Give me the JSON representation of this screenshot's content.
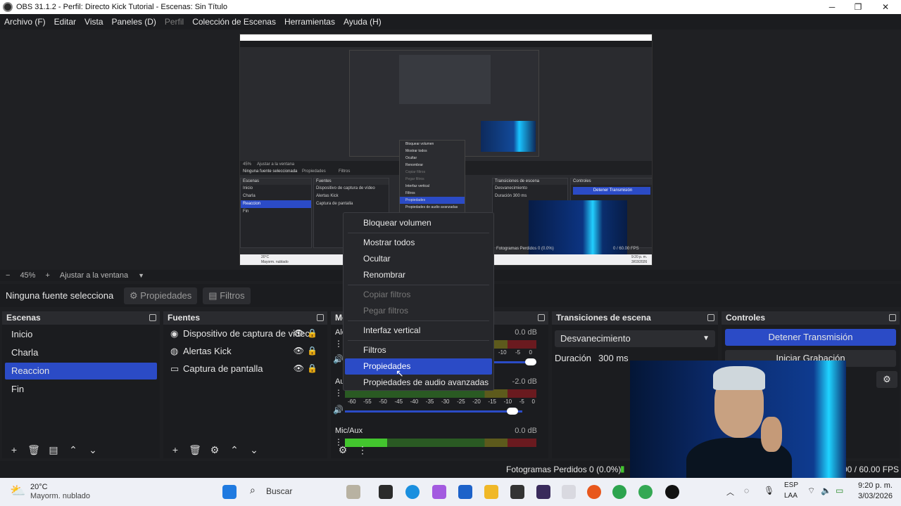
{
  "window": {
    "title": "OBS 31.1.2 - Perfil: Directo Kick Tutorial - Escenas: Sin Título",
    "minimize": "─",
    "maximize": "❐",
    "close": "✕"
  },
  "menu": [
    "Archivo (F)",
    "Editar",
    "Vista",
    "Paneles (D)",
    "Perfil",
    "Colección de Escenas",
    "Herramientas",
    "Ayuda (H)"
  ],
  "preview": {
    "nested_menu": [
      "Bloquear volumen",
      "Mostrar todos",
      "Ocultar",
      "Renombrar",
      "Copiar filtros",
      "Pegar filtros",
      "Interfaz vertical",
      "Filtros",
      "Propiedades",
      "Propiedades de audio avanzadas"
    ],
    "panels": {
      "escenas": "Escenas",
      "fuentes": "Fuentes",
      "transiciones": "Transiciones de escena",
      "controles": "Controles",
      "scenes": [
        "Inicio",
        "Charla",
        "Reaccion",
        "Fin"
      ],
      "sources": [
        "Dispositivo de captura de vídeo",
        "Alertas Kick",
        "Captura de pantalla"
      ],
      "fade": "Desvanecimiento",
      "duration_label": "Duración",
      "duration": "300 ms",
      "stop": "Detener Transmisión",
      "no_source": "Ninguna fuente seleccionada",
      "props": "Propiedades",
      "filters": "Filtros",
      "zoom": "45%",
      "fit": "Ajustar a la ventana"
    },
    "taskbar": {
      "temp": "20°C",
      "weather": "Mayorm. nublado",
      "time": "9:20 p. m.",
      "date": "3/03/2026",
      "frames": "Fotogramas Perdidos 0 (0.0%)",
      "fps": "0 / 60.00 FPS"
    }
  },
  "zoom": {
    "minus": "−",
    "value": "45%",
    "plus": "+",
    "fit": "Ajustar a la ventana",
    "caret": "▼"
  },
  "source_bar": {
    "no_selection": "Ninguna fuente selecciona",
    "properties": "Propiedades",
    "filters": "Filtros"
  },
  "scenes": {
    "title": "Escenas",
    "items": [
      "Inicio",
      "Charla",
      "Reaccion",
      "Fin"
    ],
    "selected": "Reaccion"
  },
  "sources": {
    "title": "Fuentes",
    "items": [
      "Dispositivo de captura de videc",
      "Alertas Kick",
      "Captura de pantalla"
    ]
  },
  "mixer": {
    "title": "Me",
    "ch1_label": "Ale",
    "ch1_db": "0.0 dB",
    "ch2_label": "Au",
    "ch2_db": "-2.0 dB",
    "ch3_label": "Mic/Aux",
    "ch3_db": "0.0 dB",
    "scale": [
      "-60",
      "-55",
      "-50",
      "-45",
      "-40",
      "-35",
      "-30",
      "-25",
      "-20",
      "-15",
      "-10",
      "-5",
      "0"
    ],
    "scale_partial": [
      "-10",
      "-5",
      "0"
    ],
    "levels": {
      "ch1": 0.0,
      "ch2": 0.0,
      "ch3": 0.22
    }
  },
  "transitions": {
    "title": "Transiciones de escena",
    "selected": "Desvanecimiento",
    "duration_label": "Duración",
    "duration": "300 ms"
  },
  "controls": {
    "title": "Controles",
    "stop_stream": "Detener Transmisión",
    "start_record": "Iniciar Grabación"
  },
  "context_menu": {
    "items": [
      {
        "label": "Bloquear volumen",
        "disabled": false
      },
      {
        "label": "Mostrar todos",
        "disabled": false
      },
      {
        "label": "Ocultar",
        "disabled": false
      },
      {
        "label": "Renombrar",
        "disabled": false
      },
      {
        "label": "Copiar filtros",
        "disabled": true
      },
      {
        "label": "Pegar filtros",
        "disabled": true
      },
      {
        "label": "Interfaz vertical",
        "disabled": false
      },
      {
        "label": "Filtros",
        "disabled": false
      },
      {
        "label": "Propiedades",
        "disabled": false,
        "highlighted": true
      },
      {
        "label": "Propiedades de audio avanzadas",
        "disabled": false
      }
    ]
  },
  "status": {
    "frames": "Fotogramas Perdidos 0 (0.0%)",
    "fps": "00 / 60.00 FPS"
  },
  "taskbar": {
    "temp": "20°C",
    "weather": "Mayorm. nublado",
    "search": "Buscar",
    "lang1": "ESP",
    "lang2": "LAA",
    "time": "9:20 p. m.",
    "date": "3/03/2026"
  },
  "colors": {
    "accent": "#2b4bc6",
    "bg": "#1b1c1f",
    "panel_header": "#2a2b2f"
  }
}
